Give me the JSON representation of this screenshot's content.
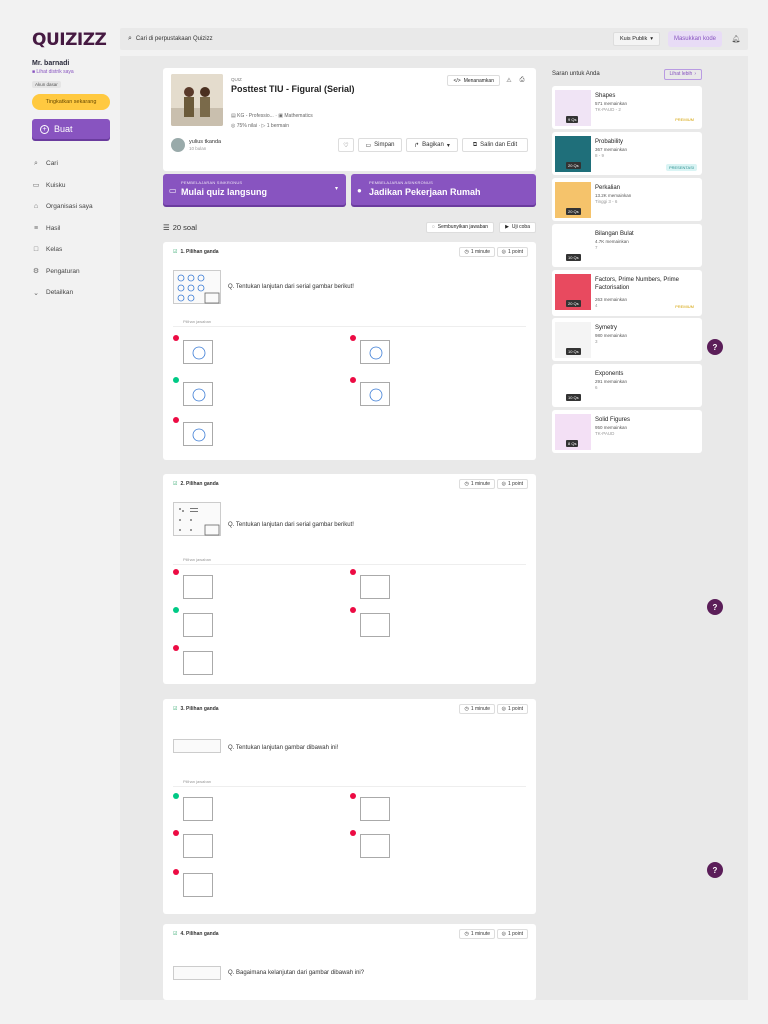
{
  "brand": {
    "logo": "QUIZIZZ"
  },
  "user": {
    "name": "Mr. barnadi",
    "district_link": "Lihat distrik saya",
    "account_type": "Akun dasar",
    "upgrade_label": "Tingkatkan sekarang"
  },
  "create_label": "Buat",
  "nav": [
    {
      "icon": "search-icon",
      "label": "Cari"
    },
    {
      "icon": "book-icon",
      "label": "Kuisku"
    },
    {
      "icon": "building-icon",
      "label": "Organisasi saya"
    },
    {
      "icon": "chart-icon",
      "label": "Hasil"
    },
    {
      "icon": "class-icon",
      "label": "Kelas"
    },
    {
      "icon": "gear-icon",
      "label": "Pengaturan"
    },
    {
      "icon": "chevron-down-icon",
      "label": "Detailkan"
    }
  ],
  "topbar": {
    "search_placeholder": "Cari di perpustakaan Quizizz",
    "visibility_label": "Kuis Publik",
    "join_code_label": "Masukkan kode"
  },
  "quiz": {
    "type_label": "QUIZ",
    "title": "Posttest TIU - Figural (Serial)",
    "grade": "KG - Professio...",
    "subject": "Mathematics",
    "accuracy": "75% nilai",
    "plays": "1 bermain",
    "embed_label": "Menanamkan",
    "author_name": "yulius tkanda",
    "author_time": "10 bulan",
    "save_label": "Simpan",
    "share_label": "Bagikan",
    "copy_edit_label": "Salin dan Edit"
  },
  "assign": {
    "live": {
      "small": "PEMBELAJARAN SINKRONUS",
      "big": "Mulai quiz langsung"
    },
    "homework": {
      "small": "PEMBELAJARAN ASINKRONUS",
      "big": "Jadikan Pekerjaan Rumah"
    }
  },
  "questions_meta": {
    "count_label": "20 soal",
    "hide_answers_label": "Sembunyikan jawaban",
    "try_label": "Uji coba",
    "choices_label": "Pilihan jawaban"
  },
  "questions": [
    {
      "type": "1. Pilihan ganda",
      "time": "1 minute",
      "points": "1 point",
      "text": "Q. Tentukan lanjutan dari serial gambar berikut!"
    },
    {
      "type": "2. Pilihan ganda",
      "time": "1 minute",
      "points": "1 point",
      "text": "Q. Tentukan lanjutan dari serial gambar berikut!"
    },
    {
      "type": "3. Pilihan ganda",
      "time": "1 minute",
      "points": "1 point",
      "text": "Q. Tentukan lanjutan gambar dibawah ini!"
    },
    {
      "type": "4. Pilihan ganda",
      "time": "1 minute",
      "points": "1 point",
      "text": "Q. Bagaimana kelanjutan dari gambar dibawah ini?"
    }
  ],
  "recommendations": {
    "title": "Saran untuk Anda",
    "more_label": "Lihat lebih",
    "items": [
      {
        "name": "Shapes",
        "plays": "571 memainkan",
        "grade": "TK-PAUD - 2",
        "count": "9 Qs",
        "badge": "PREMIUM"
      },
      {
        "name": "Probability",
        "plays": "367 memainkan",
        "grade": "8 - 9",
        "count": "20 Qs",
        "badge": "PRESENTASI"
      },
      {
        "name": "Perkalian",
        "plays": "13.2K memainkan",
        "grade": "Tinggi 3 - 6",
        "count": "20 Qs",
        "badge": ""
      },
      {
        "name": "Bilangan Bulat",
        "plays": "4.7K memainkan",
        "grade": "7",
        "count": "10 Qs",
        "badge": ""
      },
      {
        "name": "Factors, Prime Numbers, Prime Factorisation",
        "plays": "263 memainkan",
        "grade": "4",
        "count": "20 Qs",
        "badge": "PREMIUM"
      },
      {
        "name": "Symetry",
        "plays": "980 memainkan",
        "grade": "3",
        "count": "10 Qs",
        "badge": ""
      },
      {
        "name": "Exponents",
        "plays": "291 memainkan",
        "grade": "6",
        "count": "10 Qs",
        "badge": ""
      },
      {
        "name": "Solid Figures",
        "plays": "950 memainkan",
        "grade": "TK-PAUD",
        "count": "8 Qs",
        "badge": ""
      }
    ]
  },
  "help_label": "?"
}
